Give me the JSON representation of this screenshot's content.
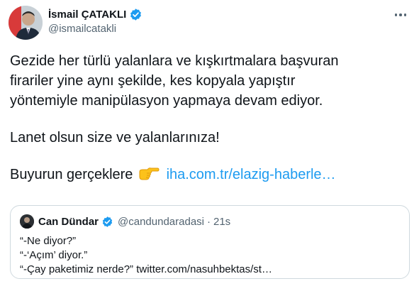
{
  "tweet": {
    "author": {
      "name": "İsmail ÇATAKLI",
      "handle": "@ismailcatakli",
      "verified": true
    },
    "text_lines": [
      "Gezide her türlü yalanlara ve kışkırtmalara başvuran",
      "firariler yine aynı şekilde, kes kopyala yapıştır",
      "yöntemiyle manipülasyon yapmaya devam ediyor."
    ],
    "line2": "Lanet olsun size ve yalanlarınıza!",
    "line3_text": "Buyurun gerçeklere",
    "line3_emoji_icon": "backhand-index-pointing-right",
    "line3_link": "iha.com.tr/elazig-haberle…"
  },
  "quoted_tweet": {
    "author": {
      "name": "Can Dündar",
      "handle": "@candundaradasi",
      "verified": true
    },
    "separator": "·",
    "time": "21s",
    "lines": [
      "“-Ne diyor?”",
      "“-‘Açım’ diyor.”",
      "“-Çay paketimiz nerde?” twitter.com/nasuhbektas/st…"
    ]
  },
  "colors": {
    "verified_badge": "#1d9bf0",
    "link": "#1d9bf0",
    "secondary_text": "#536471",
    "border": "#cfd9de"
  }
}
